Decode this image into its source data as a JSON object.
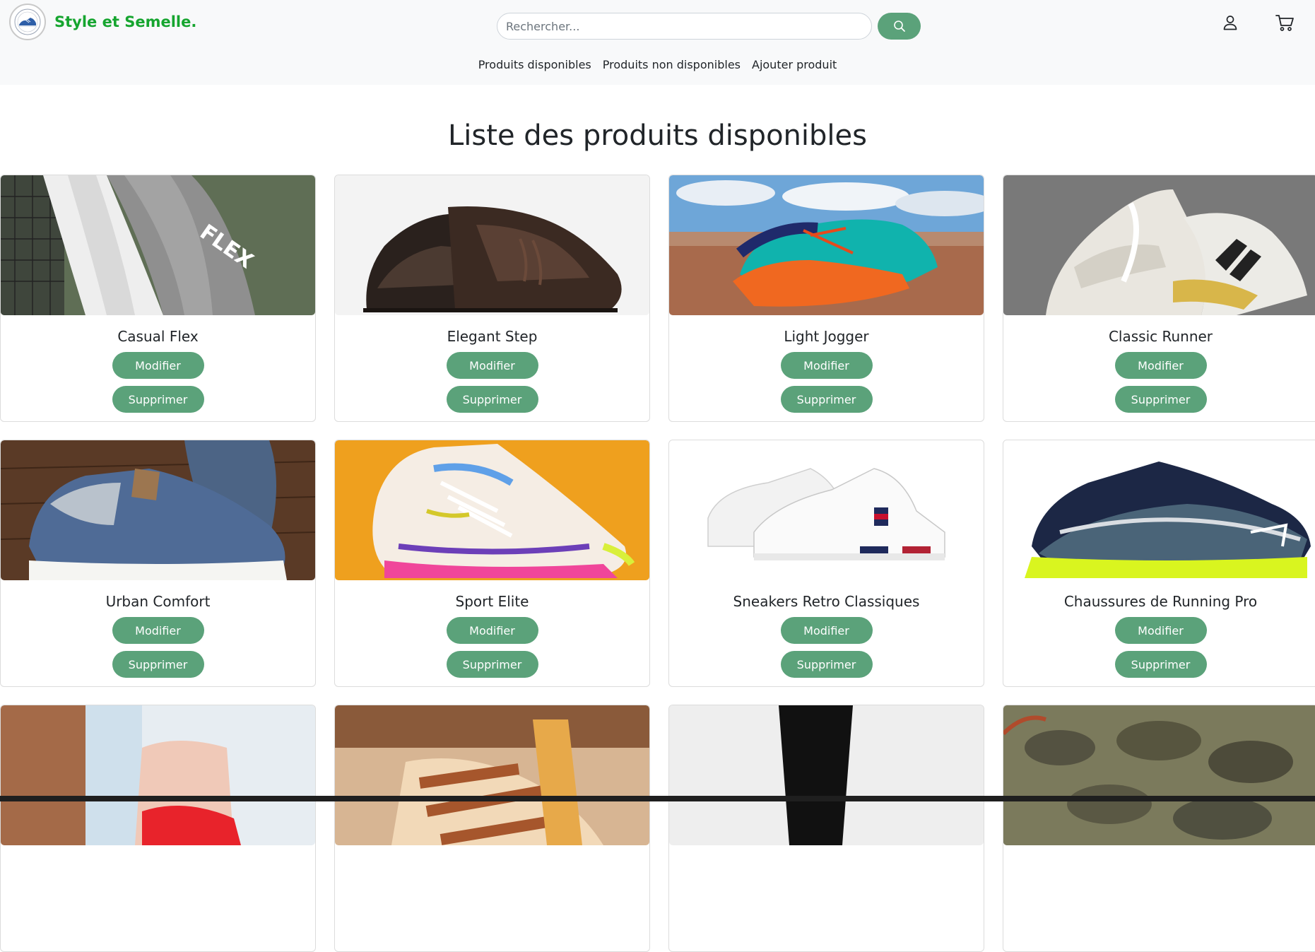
{
  "header": {
    "brand_name": "Style et Semelle.",
    "search_placeholder": "Rechercher...",
    "icons": {
      "logo": "shoe-logo-icon",
      "search": "search-icon",
      "user": "user-icon",
      "cart": "cart-icon"
    }
  },
  "nav": {
    "items": [
      {
        "label": "Produits disponibles"
      },
      {
        "label": "Produits non disponibles"
      },
      {
        "label": "Ajouter produit"
      }
    ]
  },
  "main": {
    "title": "Liste des produits disponibles",
    "edit_label": "Modifier",
    "delete_label": "Supprimer",
    "products": [
      {
        "name": "Casual Flex"
      },
      {
        "name": "Elegant Step"
      },
      {
        "name": "Light Jogger"
      },
      {
        "name": "Classic Runner"
      },
      {
        "name": "Urban Comfort"
      },
      {
        "name": "Sport Elite"
      },
      {
        "name": "Sneakers Retro Classiques"
      },
      {
        "name": "Chaussures de Running Pro"
      },
      {
        "name": ""
      },
      {
        "name": ""
      },
      {
        "name": ""
      },
      {
        "name": ""
      }
    ]
  },
  "colors": {
    "brand": "#16a52f",
    "button": "#5ba27a",
    "header_bg": "#f8f9fa"
  }
}
